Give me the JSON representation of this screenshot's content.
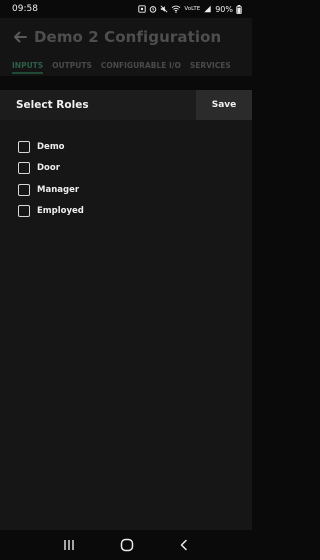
{
  "status_bar": {
    "time": "09:58",
    "network": "VoLTE",
    "battery": "90%"
  },
  "app_bar": {
    "title": "Demo 2 Configuration"
  },
  "tabs": [
    {
      "label": "INPUTS",
      "active": true
    },
    {
      "label": "OUTPUTS",
      "active": false
    },
    {
      "label": "CONFIGURABLE I/O",
      "active": false
    },
    {
      "label": "SERVICES",
      "active": false
    }
  ],
  "dialog": {
    "title": "Select Roles",
    "save_label": "Save",
    "roles": [
      {
        "label": "Demo",
        "checked": false
      },
      {
        "label": "Door",
        "checked": false
      },
      {
        "label": "Manager",
        "checked": false
      },
      {
        "label": "Employed",
        "checked": false
      }
    ]
  },
  "colors": {
    "background": "#0a0a0a",
    "dialog": "#161616",
    "active_tab": "#2e5f49"
  },
  "icons": [
    "back-arrow-icon",
    "nav-recents-icon",
    "nav-home-icon",
    "nav-back-icon"
  ]
}
